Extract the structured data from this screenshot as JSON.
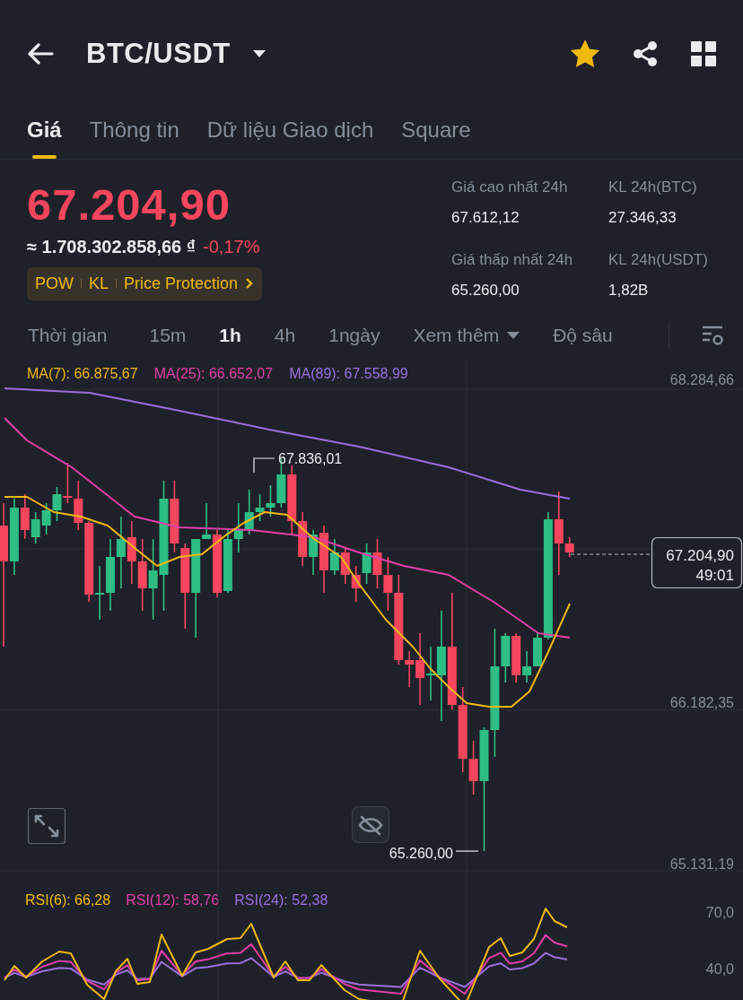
{
  "header": {
    "pair": "BTC/USDT",
    "favorite": true
  },
  "tabs": [
    {
      "label": "Giá",
      "selected": true
    },
    {
      "label": "Thông tin",
      "selected": false
    },
    {
      "label": "Dữ liệu Giao dịch",
      "selected": false
    },
    {
      "label": "Square",
      "selected": false
    }
  ],
  "price": {
    "last": "67.204,90",
    "fiat": "≈ 1.708.302.858,66 ₫",
    "change": "-0,17%"
  },
  "tags": [
    "POW",
    "KL",
    "Price Protection"
  ],
  "stats": [
    {
      "label": "Giá cao nhất 24h",
      "value": "67.612,12"
    },
    {
      "label": "KL 24h(BTC)",
      "value": "27.346,33"
    },
    {
      "label": "Giá thấp nhất 24h",
      "value": "65.260,00"
    },
    {
      "label": "KL 24h(USDT)",
      "value": "1,82B"
    }
  ],
  "intervals": [
    {
      "label": "Thời gian",
      "kind": "text",
      "selected": false
    },
    {
      "label": "15m",
      "kind": "text",
      "selected": false
    },
    {
      "label": "1h",
      "kind": "text",
      "selected": true
    },
    {
      "label": "4h",
      "kind": "text",
      "selected": false
    },
    {
      "label": "1ngày",
      "kind": "text",
      "selected": false
    },
    {
      "label": "Xem thêm",
      "kind": "dropdown",
      "selected": false
    },
    {
      "label": "Độ sâu",
      "kind": "text",
      "selected": false
    }
  ],
  "chart": {
    "legend": [
      {
        "label": "MA(7): 66.875,67",
        "color": "#f0b90b"
      },
      {
        "label": "MA(25): 66.652,07",
        "color": "#e040a8"
      },
      {
        "label": "MA(89): 67.558,99",
        "color": "#9b6fdc"
      }
    ],
    "y_axis": [
      "68.284,66",
      "66.182,35",
      "65.131,19"
    ],
    "high_label": "67.836,01",
    "low_label": "65.260,00",
    "price_tag": {
      "price": "67.204,90",
      "countdown": "49:01"
    }
  },
  "rsi": {
    "legend": [
      {
        "label": "RSI(6): 66,28",
        "color": "#f0b90b"
      },
      {
        "label": "RSI(12): 58,76",
        "color": "#e040a8"
      },
      {
        "label": "RSI(24): 52,38",
        "color": "#9b6fdc"
      }
    ],
    "y_axis": [
      "70,0",
      "40,0"
    ]
  }
}
